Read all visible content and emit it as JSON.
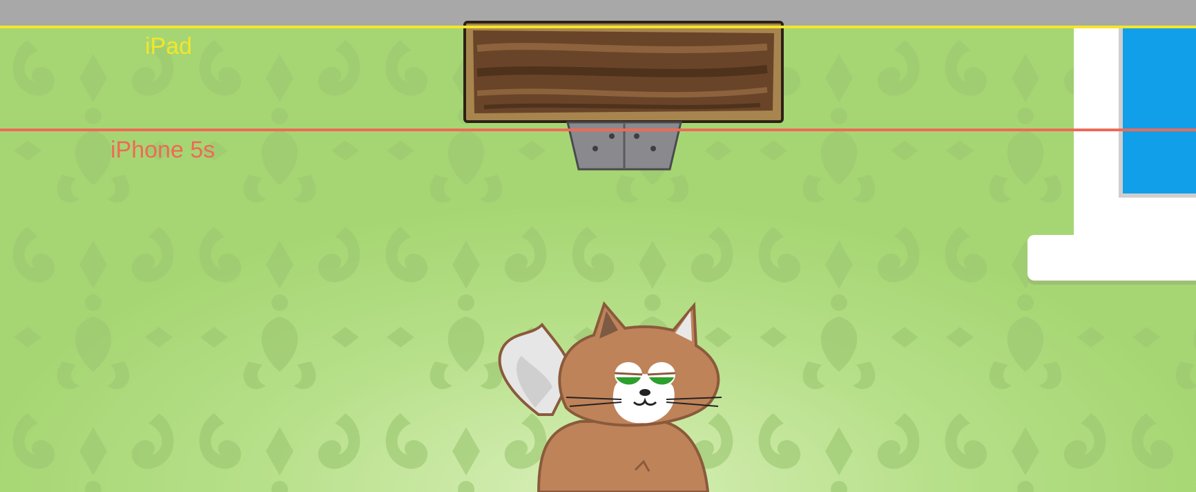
{
  "guides": {
    "ipad_label": "iPad",
    "iphone_label": "iPhone 5s",
    "ipad_color": "#f3e62a",
    "iphone_color": "#ee6a56"
  },
  "scene": {
    "wallpaper_color": "#b7e08a",
    "window_glass_color": "#119fe9",
    "shelf_color": "#7a5230"
  },
  "icons": [
    "damask-wallpaper",
    "wooden-shelf",
    "metal-bracket",
    "window",
    "cat-character"
  ]
}
